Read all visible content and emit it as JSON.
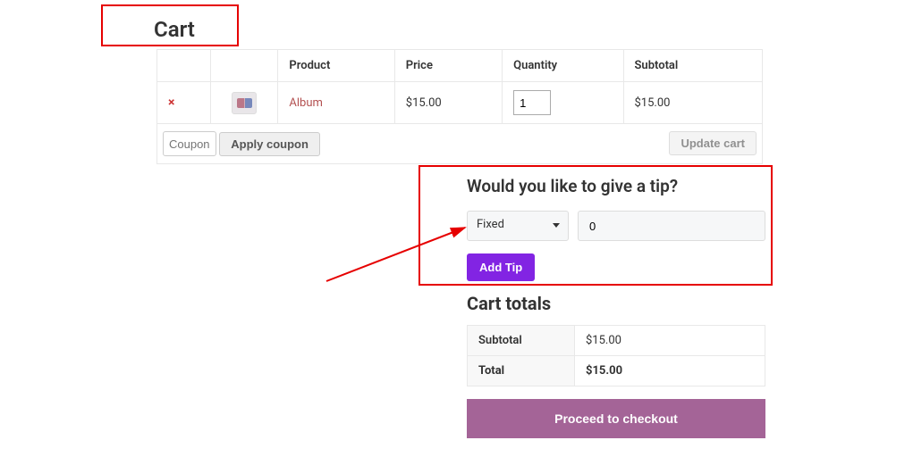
{
  "page_title": "Cart",
  "table": {
    "headers": {
      "product": "Product",
      "price": "Price",
      "quantity": "Quantity",
      "subtotal": "Subtotal"
    },
    "rows": [
      {
        "remove_symbol": "×",
        "product_name": "Album",
        "price": "$15.00",
        "quantity": "1",
        "subtotal": "$15.00"
      }
    ],
    "coupon_placeholder": "Coupon code",
    "apply_coupon_label": "Apply coupon",
    "update_cart_label": "Update cart"
  },
  "tips": {
    "heading": "Would you like to give a tip?",
    "select_value": "Fixed",
    "amount_value": "0",
    "add_tip_label": "Add Tip"
  },
  "totals": {
    "heading": "Cart totals",
    "subtotal_label": "Subtotal",
    "subtotal_value": "$15.00",
    "total_label": "Total",
    "total_value": "$15.00",
    "checkout_label": "Proceed to checkout"
  }
}
